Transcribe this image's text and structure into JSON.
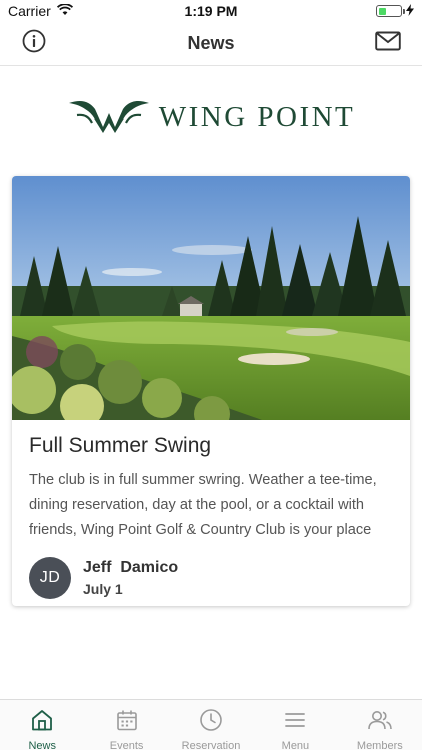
{
  "status_bar": {
    "carrier": "Carrier",
    "time": "1:19 PM",
    "battery_level": 0.35
  },
  "nav": {
    "title": "News",
    "left_icon": "info-icon",
    "right_icon": "mail-icon"
  },
  "logo": {
    "text": "WING POINT",
    "color": "#1f4a35"
  },
  "article": {
    "title": "Full Summer Swing",
    "excerpt": "The club is in full summer swring.  Weather a tee-time, dining reservation, day at the pool, or a cocktail with friends, Wing Point Golf & Country Club is your place f…",
    "author_initials": "JD",
    "author_name": "Jeff  Damico",
    "date": "July 1"
  },
  "tabs": [
    {
      "label": "News",
      "icon": "home-icon",
      "active": true
    },
    {
      "label": "Events",
      "icon": "calendar-icon",
      "active": false
    },
    {
      "label": "Reservation",
      "icon": "clock-icon",
      "active": false
    },
    {
      "label": "Menu",
      "icon": "menu-icon",
      "active": false
    },
    {
      "label": "Members",
      "icon": "members-icon",
      "active": false
    }
  ],
  "colors": {
    "accent": "#1f5f48",
    "inactive": "#9a9a9a"
  }
}
